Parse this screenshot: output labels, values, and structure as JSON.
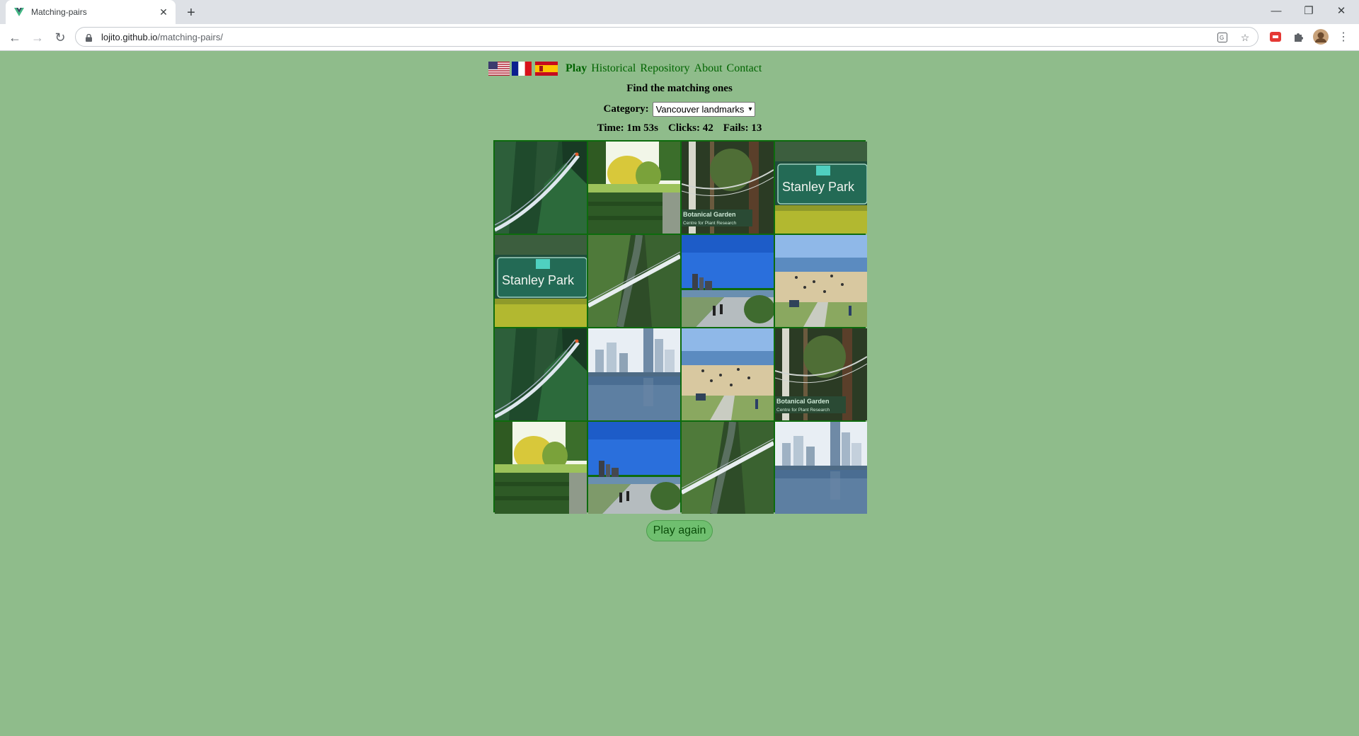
{
  "browser": {
    "tab_title": "Matching-pairs",
    "url_domain": "lojito.github.io",
    "url_path": "/matching-pairs/"
  },
  "nav": {
    "flags": [
      "us-flag-icon",
      "fr-flag-icon",
      "es-flag-icon"
    ],
    "links": [
      "Play",
      "Historical",
      "Repository",
      "About",
      "Contact"
    ],
    "active": "Play"
  },
  "heading": "Find the matching ones",
  "category": {
    "label": "Category:",
    "selected": "Vancouver landmarks"
  },
  "stats": {
    "time": "Time: 1m 53s",
    "clicks": "Clicks: 42",
    "fails": "Fails: 13"
  },
  "cards": [
    "capilano-bridge-tall",
    "garden-maze",
    "ubc-botanical-garden",
    "stanley-park-sign",
    "stanley-park-sign",
    "capilano-bridge-canyon",
    "seawall-skyline",
    "english-bay-beach",
    "capilano-bridge-tall",
    "coal-harbour-towers",
    "english-bay-beach",
    "ubc-botanical-garden",
    "garden-maze",
    "seawall-skyline",
    "capilano-bridge-canyon",
    "coal-harbour-towers"
  ],
  "card_text": {
    "stanley": "Stanley Park",
    "ubc_line1": "Botanical Garden",
    "ubc_line2": "Centre for Plant Research"
  },
  "play_again": "Play again",
  "colors": {
    "page_bg": "#8fbc8b",
    "link": "#006400",
    "grid_border": "#0d6b0d",
    "button_bg": "#6fbf6f"
  }
}
